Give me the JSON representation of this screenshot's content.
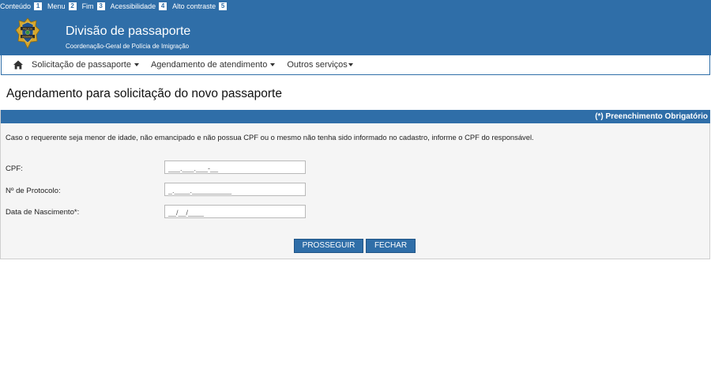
{
  "accessibility_bar": {
    "items": [
      {
        "label": "Conteúdo",
        "key": "1"
      },
      {
        "label": "Menu",
        "key": "2"
      },
      {
        "label": "Fim",
        "key": "3"
      },
      {
        "label": "Acessibilidade",
        "key": "4"
      },
      {
        "label": "Alto contraste",
        "key": "5"
      }
    ]
  },
  "header": {
    "title": "Divisão de passaporte",
    "subtitle": "Coordenação-Geral de Polícia de Imigração",
    "logo_text": [
      "POLÍCIA",
      "FEDERAL"
    ]
  },
  "nav": {
    "items": [
      {
        "label": "Solicitação de passaporte"
      },
      {
        "label": "Agendamento de atendimento"
      },
      {
        "label": "Outros serviços"
      }
    ]
  },
  "page": {
    "title": "Agendamento para solicitação do novo passaporte"
  },
  "form": {
    "required_note": "(*) Preenchimento Obrigatório",
    "info": "Caso o requerente seja menor de idade, não emancipado e não possua CPF ou o mesmo não tenha sido informado no cadastro, informe o CPF do responsável.",
    "fields": [
      {
        "label": "CPF:",
        "value": "___.___.___-__"
      },
      {
        "label": "Nº de Protocolo:",
        "value": "_.____.__________"
      },
      {
        "label": "Data de Nascimento*:",
        "value": "__/__/____"
      }
    ],
    "buttons": {
      "proceed": "PROSSEGUIR",
      "close": "FECHAR"
    }
  },
  "colors": {
    "brand_blue": "#2f6ea8",
    "panel_bg": "#f5f5f5"
  }
}
